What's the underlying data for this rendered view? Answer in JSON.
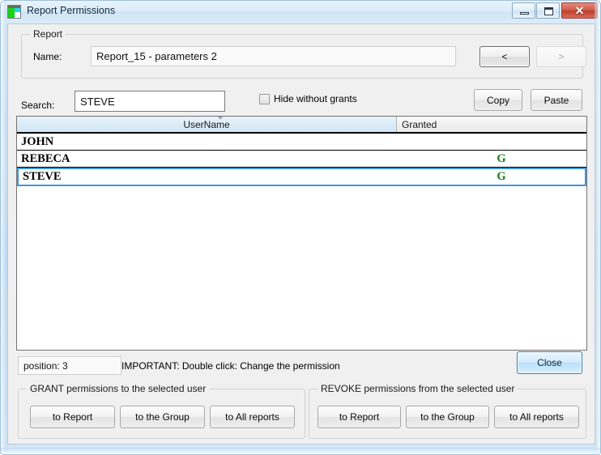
{
  "window": {
    "title": "Report Permissions",
    "icon": "report-permissions-icon",
    "minimize_label": "",
    "maximize_label": "",
    "close_label": "✕"
  },
  "report_group": {
    "legend": "Report",
    "name_label": "Name:",
    "name_value": "Report_15 - parameters 2",
    "prev_label": "<",
    "next_label": ">"
  },
  "search_row": {
    "label": "Search:",
    "value": "STEVE",
    "placeholder": "",
    "hide_without_grants_label": "Hide without grants",
    "hide_without_grants_checked": false,
    "copy_label": "Copy",
    "paste_label": "Paste"
  },
  "grid": {
    "columns": [
      "UserName",
      "Granted"
    ],
    "rows": [
      {
        "username": "JOHN",
        "granted": ""
      },
      {
        "username": "REBECA",
        "granted": "G"
      },
      {
        "username": "STEVE",
        "granted": "G"
      }
    ],
    "selected_row_index": 2,
    "granted_color": "#1a7a1a"
  },
  "status": {
    "position_label": "position:",
    "position_value": "3",
    "position_text": "position:  3",
    "important_text": "IMPORTANT:  Double click: Change the permission",
    "close_label": "Close"
  },
  "grant_group": {
    "legend": "GRANT permissions to the selected user",
    "buttons": [
      "to Report",
      "to the Group",
      "to All reports"
    ]
  },
  "revoke_group": {
    "legend": "REVOKE permissions from the selected user",
    "buttons": [
      "to Report",
      "to the Group",
      "to All reports"
    ]
  }
}
